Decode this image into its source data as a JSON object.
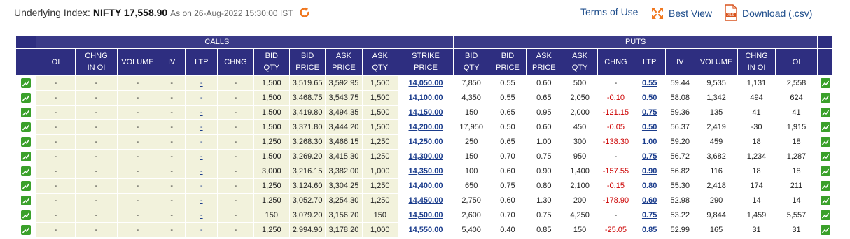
{
  "underlying": {
    "label": "Underlying Index:",
    "value": "NIFTY 17,558.90",
    "as_of": "As on 26-Aug-2022 15:30:00 IST"
  },
  "links": {
    "terms": "Terms of Use",
    "best_view": "Best View",
    "download": "Download (.csv)"
  },
  "table": {
    "group_calls": "CALLS",
    "group_puts": "PUTS",
    "headers": {
      "c_oi": [
        "OI"
      ],
      "c_chng_oi": [
        "CHNG",
        "IN OI"
      ],
      "c_volume": [
        "VOLUME"
      ],
      "c_iv": [
        "IV"
      ],
      "c_ltp": [
        "LTP"
      ],
      "c_chng": [
        "CHNG"
      ],
      "c_bid_qty": [
        "BID",
        "QTY"
      ],
      "c_bid_price": [
        "BID",
        "PRICE"
      ],
      "c_ask_price": [
        "ASK",
        "PRICE"
      ],
      "c_ask_qty": [
        "ASK",
        "QTY"
      ],
      "strike": [
        "STRIKE",
        "PRICE"
      ],
      "p_bid_qty": [
        "BID",
        "QTY"
      ],
      "p_bid_price": [
        "BID",
        "PRICE"
      ],
      "p_ask_price": [
        "ASK",
        "PRICE"
      ],
      "p_ask_qty": [
        "ASK",
        "QTY"
      ],
      "p_chng": [
        "CHNG"
      ],
      "p_ltp": [
        "LTP"
      ],
      "p_iv": [
        "IV"
      ],
      "p_volume": [
        "VOLUME"
      ],
      "p_chng_oi": [
        "CHNG",
        "IN OI"
      ],
      "p_oi": [
        "OI"
      ]
    },
    "rows": [
      {
        "c_oi": "-",
        "c_chng_oi": "-",
        "c_volume": "-",
        "c_iv": "-",
        "c_ltp": "-",
        "c_chng": "-",
        "c_bid_qty": "1,500",
        "c_bid_price": "3,519.65",
        "c_ask_price": "3,592.95",
        "c_ask_qty": "1,500",
        "strike": "14,050.00",
        "p_bid_qty": "7,850",
        "p_bid_price": "0.55",
        "p_ask_price": "0.60",
        "p_ask_qty": "500",
        "p_chng": "-",
        "p_ltp": "0.55",
        "p_iv": "59.44",
        "p_volume": "9,535",
        "p_chng_oi": "1,131",
        "p_oi": "2,558"
      },
      {
        "c_oi": "-",
        "c_chng_oi": "-",
        "c_volume": "-",
        "c_iv": "-",
        "c_ltp": "-",
        "c_chng": "-",
        "c_bid_qty": "1,500",
        "c_bid_price": "3,468.75",
        "c_ask_price": "3,543.75",
        "c_ask_qty": "1,500",
        "strike": "14,100.00",
        "p_bid_qty": "4,350",
        "p_bid_price": "0.55",
        "p_ask_price": "0.65",
        "p_ask_qty": "2,050",
        "p_chng": "-0.10",
        "p_ltp": "0.50",
        "p_iv": "58.08",
        "p_volume": "1,342",
        "p_chng_oi": "494",
        "p_oi": "624"
      },
      {
        "c_oi": "-",
        "c_chng_oi": "-",
        "c_volume": "-",
        "c_iv": "-",
        "c_ltp": "-",
        "c_chng": "-",
        "c_bid_qty": "1,500",
        "c_bid_price": "3,419.80",
        "c_ask_price": "3,494.35",
        "c_ask_qty": "1,500",
        "strike": "14,150.00",
        "p_bid_qty": "150",
        "p_bid_price": "0.65",
        "p_ask_price": "0.95",
        "p_ask_qty": "2,000",
        "p_chng": "-121.15",
        "p_ltp": "0.75",
        "p_iv": "59.36",
        "p_volume": "135",
        "p_chng_oi": "41",
        "p_oi": "41"
      },
      {
        "c_oi": "-",
        "c_chng_oi": "-",
        "c_volume": "-",
        "c_iv": "-",
        "c_ltp": "-",
        "c_chng": "-",
        "c_bid_qty": "1,500",
        "c_bid_price": "3,371.80",
        "c_ask_price": "3,444.20",
        "c_ask_qty": "1,500",
        "strike": "14,200.00",
        "p_bid_qty": "17,950",
        "p_bid_price": "0.50",
        "p_ask_price": "0.60",
        "p_ask_qty": "450",
        "p_chng": "-0.05",
        "p_ltp": "0.50",
        "p_iv": "56.37",
        "p_volume": "2,419",
        "p_chng_oi": "-30",
        "p_oi": "1,915"
      },
      {
        "c_oi": "-",
        "c_chng_oi": "-",
        "c_volume": "-",
        "c_iv": "-",
        "c_ltp": "-",
        "c_chng": "-",
        "c_bid_qty": "1,250",
        "c_bid_price": "3,268.30",
        "c_ask_price": "3,466.15",
        "c_ask_qty": "1,250",
        "strike": "14,250.00",
        "p_bid_qty": "250",
        "p_bid_price": "0.65",
        "p_ask_price": "1.00",
        "p_ask_qty": "300",
        "p_chng": "-138.30",
        "p_ltp": "1.00",
        "p_iv": "59.20",
        "p_volume": "459",
        "p_chng_oi": "18",
        "p_oi": "18"
      },
      {
        "c_oi": "-",
        "c_chng_oi": "-",
        "c_volume": "-",
        "c_iv": "-",
        "c_ltp": "-",
        "c_chng": "-",
        "c_bid_qty": "1,500",
        "c_bid_price": "3,269.20",
        "c_ask_price": "3,415.30",
        "c_ask_qty": "1,250",
        "strike": "14,300.00",
        "p_bid_qty": "150",
        "p_bid_price": "0.70",
        "p_ask_price": "0.75",
        "p_ask_qty": "950",
        "p_chng": "-",
        "p_ltp": "0.75",
        "p_iv": "56.72",
        "p_volume": "3,682",
        "p_chng_oi": "1,234",
        "p_oi": "1,287"
      },
      {
        "c_oi": "-",
        "c_chng_oi": "-",
        "c_volume": "-",
        "c_iv": "-",
        "c_ltp": "-",
        "c_chng": "-",
        "c_bid_qty": "3,000",
        "c_bid_price": "3,216.15",
        "c_ask_price": "3,382.00",
        "c_ask_qty": "1,000",
        "strike": "14,350.00",
        "p_bid_qty": "100",
        "p_bid_price": "0.60",
        "p_ask_price": "0.90",
        "p_ask_qty": "1,400",
        "p_chng": "-157.55",
        "p_ltp": "0.90",
        "p_iv": "56.82",
        "p_volume": "116",
        "p_chng_oi": "18",
        "p_oi": "18"
      },
      {
        "c_oi": "-",
        "c_chng_oi": "-",
        "c_volume": "-",
        "c_iv": "-",
        "c_ltp": "-",
        "c_chng": "-",
        "c_bid_qty": "1,250",
        "c_bid_price": "3,124.60",
        "c_ask_price": "3,304.25",
        "c_ask_qty": "1,250",
        "strike": "14,400.00",
        "p_bid_qty": "650",
        "p_bid_price": "0.75",
        "p_ask_price": "0.80",
        "p_ask_qty": "2,100",
        "p_chng": "-0.15",
        "p_ltp": "0.80",
        "p_iv": "55.30",
        "p_volume": "2,418",
        "p_chng_oi": "174",
        "p_oi": "211"
      },
      {
        "c_oi": "-",
        "c_chng_oi": "-",
        "c_volume": "-",
        "c_iv": "-",
        "c_ltp": "-",
        "c_chng": "-",
        "c_bid_qty": "1,250",
        "c_bid_price": "3,052.70",
        "c_ask_price": "3,254.30",
        "c_ask_qty": "1,250",
        "strike": "14,450.00",
        "p_bid_qty": "2,750",
        "p_bid_price": "0.60",
        "p_ask_price": "1.30",
        "p_ask_qty": "200",
        "p_chng": "-178.90",
        "p_ltp": "0.60",
        "p_iv": "52.98",
        "p_volume": "290",
        "p_chng_oi": "14",
        "p_oi": "14"
      },
      {
        "c_oi": "-",
        "c_chng_oi": "-",
        "c_volume": "-",
        "c_iv": "-",
        "c_ltp": "-",
        "c_chng": "-",
        "c_bid_qty": "150",
        "c_bid_price": "3,079.20",
        "c_ask_price": "3,156.70",
        "c_ask_qty": "150",
        "strike": "14,500.00",
        "p_bid_qty": "2,600",
        "p_bid_price": "0.70",
        "p_ask_price": "0.75",
        "p_ask_qty": "4,250",
        "p_chng": "-",
        "p_ltp": "0.75",
        "p_iv": "53.22",
        "p_volume": "9,844",
        "p_chng_oi": "1,459",
        "p_oi": "5,557"
      },
      {
        "c_oi": "-",
        "c_chng_oi": "-",
        "c_volume": "-",
        "c_iv": "-",
        "c_ltp": "-",
        "c_chng": "-",
        "c_bid_qty": "1,250",
        "c_bid_price": "2,994.90",
        "c_ask_price": "3,178.20",
        "c_ask_qty": "1,000",
        "strike": "14,550.00",
        "p_bid_qty": "5,400",
        "p_bid_price": "0.40",
        "p_ask_price": "0.85",
        "p_ask_qty": "150",
        "p_chng": "-25.05",
        "p_ltp": "0.85",
        "p_iv": "52.99",
        "p_volume": "165",
        "p_chng_oi": "31",
        "p_oi": "31"
      }
    ]
  },
  "colors": {
    "header_bg": "#2e2e80",
    "calls_bg": "#f2f2dc",
    "negative": "#cc0000",
    "link": "#1a3c8c",
    "chart_icon": "#3aa02a",
    "refresh_icon": "#f07820"
  },
  "icons": {
    "refresh": "refresh-icon",
    "best_view": "expand-arrows-icon",
    "download": "xls-file-icon",
    "chart": "chart-icon"
  }
}
